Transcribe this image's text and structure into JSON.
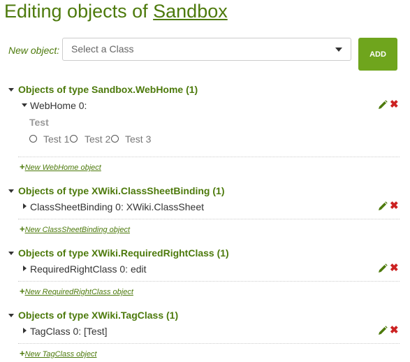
{
  "header": {
    "title_prefix": "Editing objects of ",
    "title_link": "Sandbox"
  },
  "new_object": {
    "label": "New object:",
    "select_placeholder": "Select a Class",
    "add_button": "ADD"
  },
  "sections": [
    {
      "title": "Objects of type Sandbox.WebHome (1)",
      "object_label": "WebHome 0:",
      "new_link": "New WebHome object",
      "property": {
        "title": "Test",
        "options": [
          "Test 1",
          "Test 2",
          "Test 3"
        ]
      }
    },
    {
      "title": "Objects of type XWiki.ClassSheetBinding (1)",
      "object_label": "ClassSheetBinding 0: XWiki.ClassSheet",
      "new_link": "New ClassSheetBinding object"
    },
    {
      "title": "Objects of type XWiki.RequiredRightClass (1)",
      "object_label": "RequiredRightClass 0: edit",
      "new_link": "New RequiredRightClass object"
    },
    {
      "title": "Objects of type XWiki.TagClass (1)",
      "object_label": "TagClass 0: [Test]",
      "new_link": "New TagClass object"
    }
  ],
  "icons": {
    "edit": "pencil-icon",
    "delete": "delete-x-icon",
    "add": "plus-icon"
  },
  "colors": {
    "accent": "#4d7a0c",
    "add_button": "#6fa51d",
    "delete": "#cc2222"
  }
}
